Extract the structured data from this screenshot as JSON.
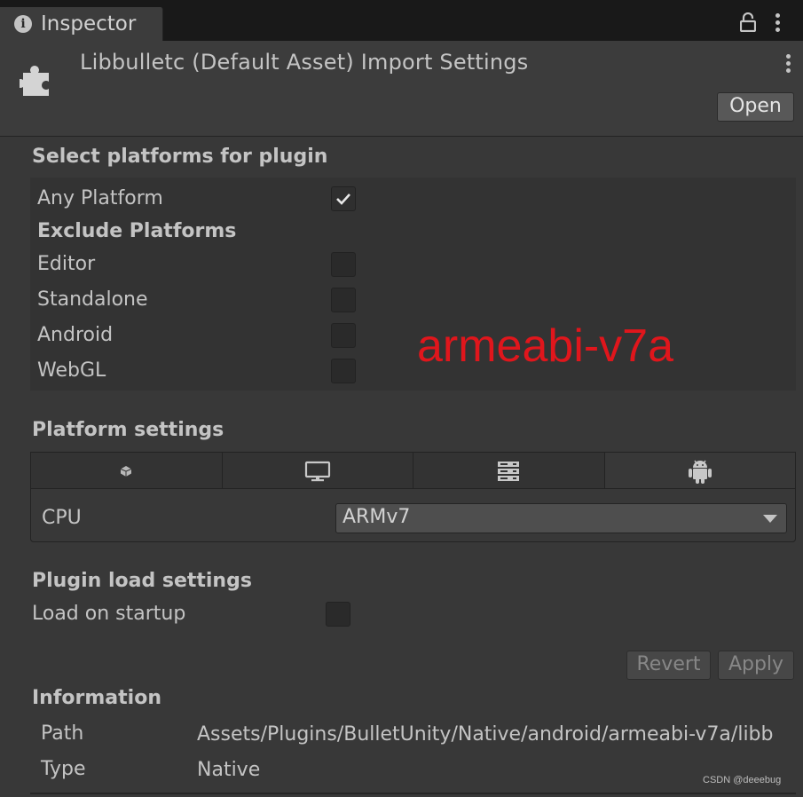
{
  "window": {
    "tab_title": "Inspector",
    "tab_icon": "info-icon",
    "lock_icon": "lock-icon",
    "menu_icon": "kebab-menu-icon"
  },
  "header": {
    "asset_icon": "puzzle-piece-icon",
    "title": "Libbulletc (Default Asset) Import Settings",
    "open_label": "Open"
  },
  "select_platforms": {
    "title": "Select platforms for plugin",
    "any_platform": {
      "label": "Any Platform",
      "checked": true
    },
    "exclude_title": "Exclude Platforms",
    "excludes": [
      {
        "label": "Editor",
        "checked": false
      },
      {
        "label": "Standalone",
        "checked": false
      },
      {
        "label": "Android",
        "checked": false
      },
      {
        "label": "WebGL",
        "checked": false
      }
    ]
  },
  "annotation": {
    "text": "armeabi-v7a",
    "color": "#e0161c"
  },
  "platform_settings": {
    "title": "Platform settings",
    "tabs": [
      {
        "icon": "unity-editor-icon",
        "selected": false
      },
      {
        "icon": "monitor-icon",
        "selected": false
      },
      {
        "icon": "server-icon",
        "selected": false
      },
      {
        "icon": "android-icon",
        "selected": true
      }
    ],
    "cpu_label": "CPU",
    "cpu_value": "ARMv7"
  },
  "plugin_load": {
    "title": "Plugin load settings",
    "load_on_startup_label": "Load on startup",
    "load_on_startup": false
  },
  "actions": {
    "revert_label": "Revert",
    "apply_label": "Apply"
  },
  "information": {
    "title": "Information",
    "path_label": "Path",
    "path_value": "Assets/Plugins/BulletUnity/Native/android/armeabi-v7a/libb",
    "type_label": "Type",
    "type_value": "Native"
  },
  "watermark": "CSDN @deeebug"
}
